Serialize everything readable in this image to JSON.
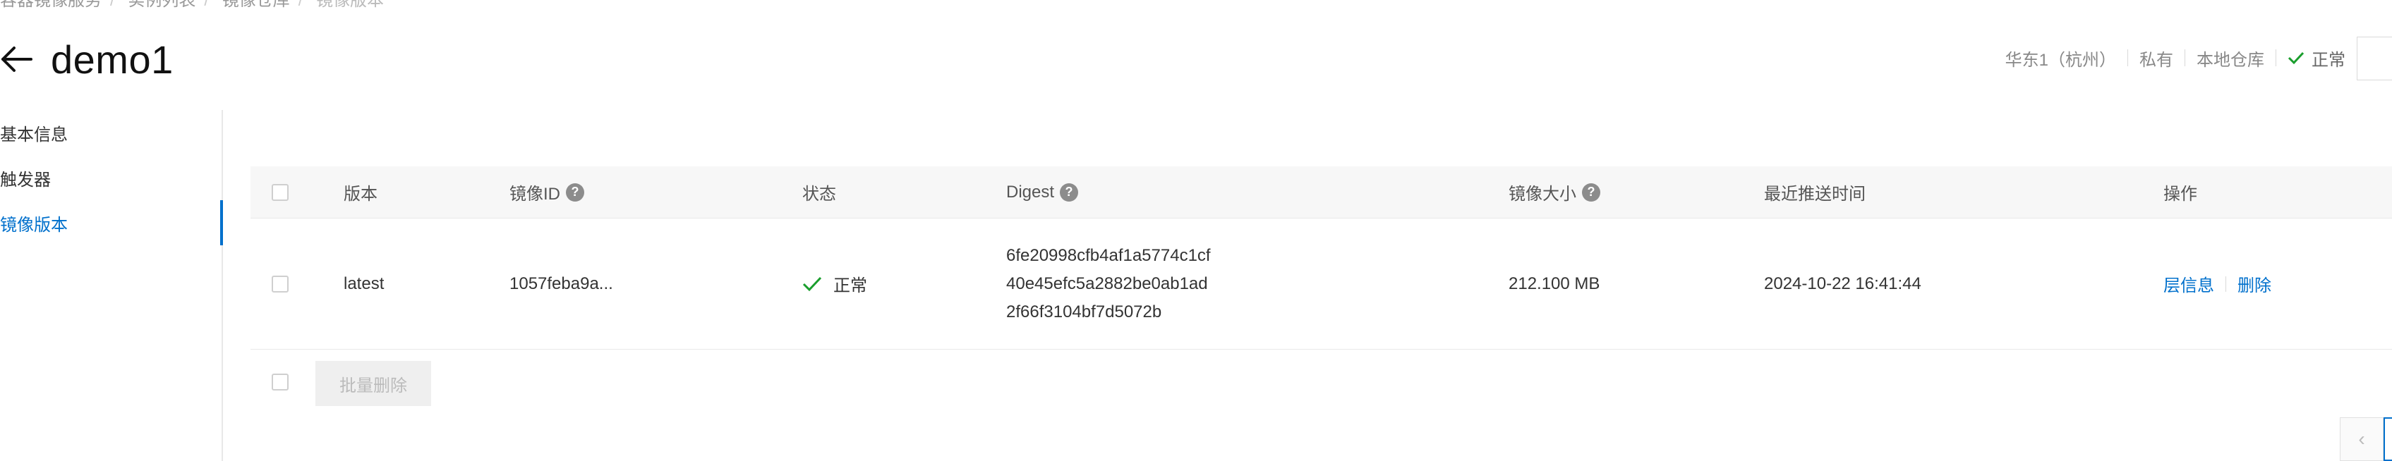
{
  "breadcrumb": {
    "items": [
      "容器镜像服务",
      "实例列表",
      "镜像仓库",
      "镜像版本"
    ]
  },
  "header": {
    "back_icon": "arrow-left-icon",
    "title": "demo1"
  },
  "meta": {
    "region": "华东1（杭州）",
    "visibility": "私有",
    "repo_type": "本地仓库",
    "status": "正常",
    "status_color": "#1a9e2d"
  },
  "sidebar": {
    "items": [
      {
        "label": "基本信息",
        "active": false
      },
      {
        "label": "触发器",
        "active": false
      },
      {
        "label": "镜像版本",
        "active": true
      }
    ],
    "accent_color": "#0070cc"
  },
  "table": {
    "columns": {
      "version": "版本",
      "image_id": "镜像ID",
      "status": "状态",
      "digest": "Digest",
      "size": "镜像大小",
      "push_time": "最近推送时间",
      "ops": "操作"
    },
    "help_icon": "question-circle-icon",
    "rows": [
      {
        "version": "latest",
        "image_id": "1057feba9a...",
        "status": "正常",
        "digest_lines": [
          "6fe20998cfb4af1a5774c1cf",
          "40e45efc5a2882be0ab1ad",
          "2f66f3104bf7d5072b"
        ],
        "size": "212.100 MB",
        "push_time": "2024-10-22 16:41:44",
        "op_layers": "层信息",
        "op_delete": "删除"
      }
    ],
    "batch_delete": "批量删除"
  },
  "pager": {
    "prev_icon": "chevron-left-icon"
  }
}
